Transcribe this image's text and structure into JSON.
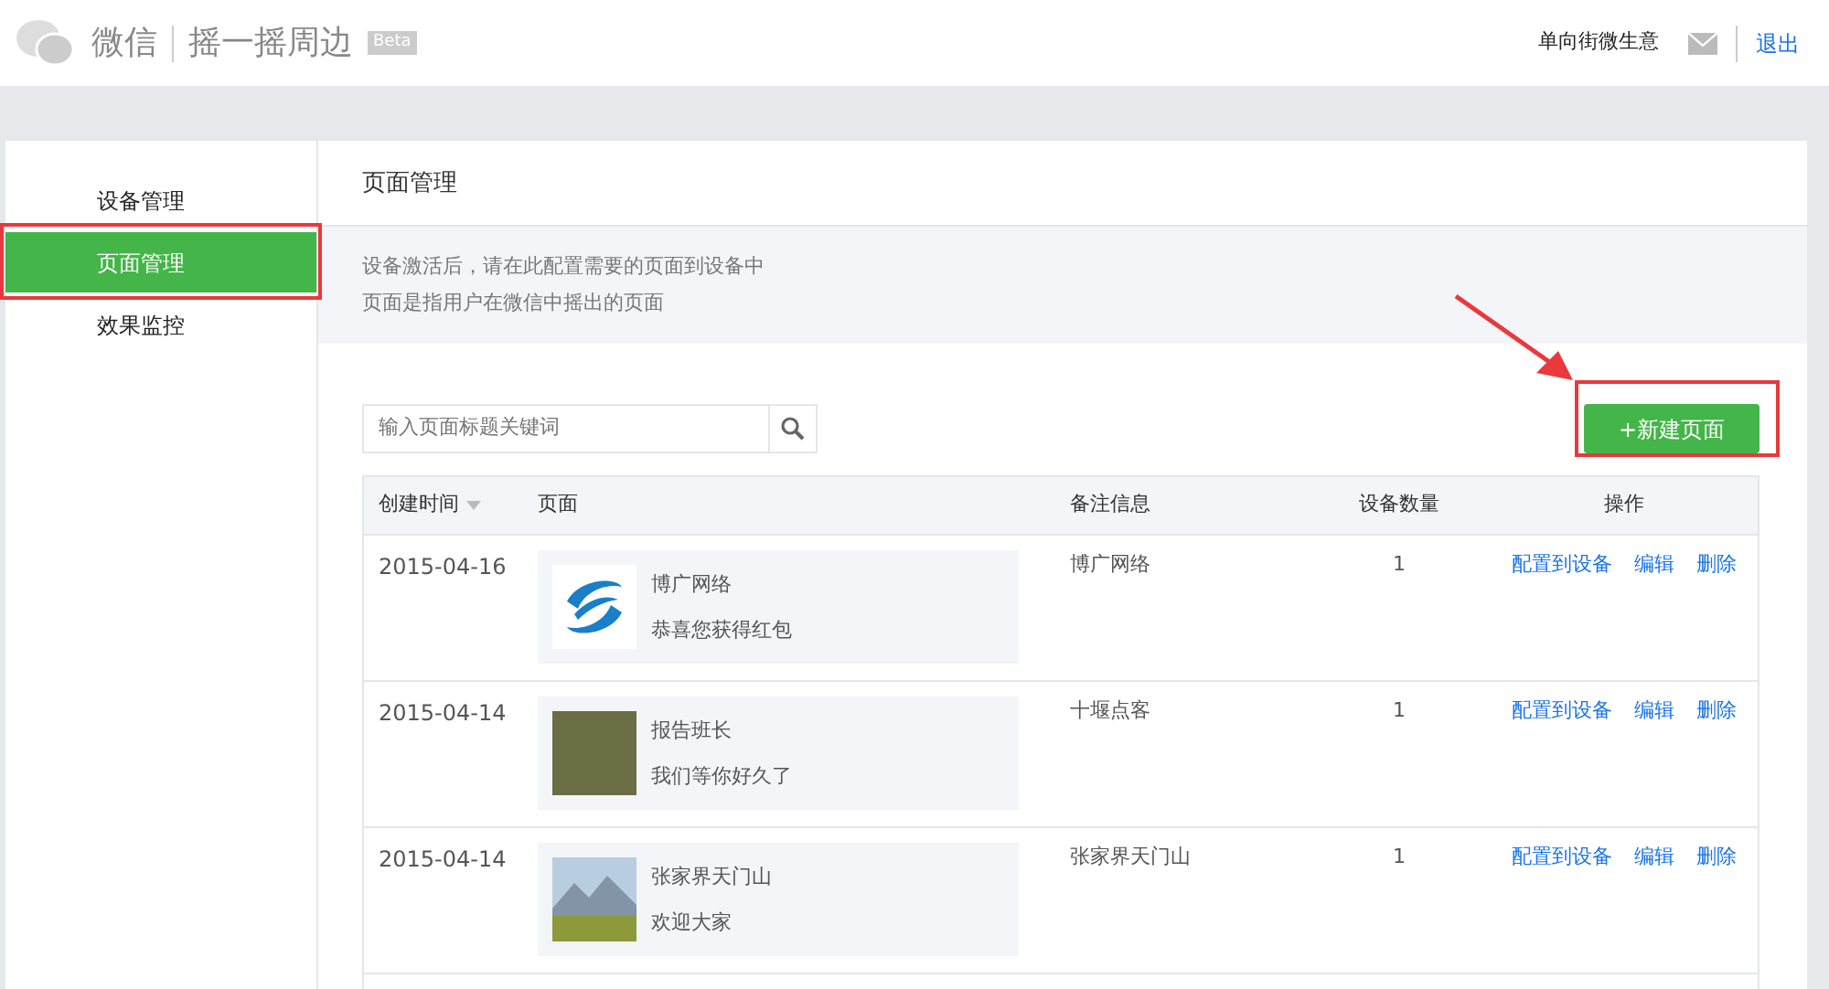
{
  "header": {
    "brand": "微信",
    "product": "摇一摇周边",
    "badge": "Beta",
    "account": "单向街微生意",
    "logout": "退出"
  },
  "sidebar": {
    "items": [
      {
        "label": "设备管理",
        "selected": false
      },
      {
        "label": "页面管理",
        "selected": true
      },
      {
        "label": "效果监控",
        "selected": false
      }
    ]
  },
  "content": {
    "title": "页面管理",
    "notes": [
      "设备激活后，请在此配置需要的页面到设备中",
      "页面是指用户在微信中摇出的页面"
    ],
    "search": {
      "placeholder": "输入页面标题关键词"
    },
    "new_button": "+新建页面",
    "table": {
      "columns": [
        "创建时间",
        "页面",
        "备注信息",
        "设备数量",
        "操作"
      ],
      "rows": [
        {
          "date": "2015-04-16",
          "kind": "logo",
          "title": "博广网络",
          "subtitle": "恭喜您获得红包",
          "note": "博广网络",
          "count": "1",
          "actions": [
            "配置到设备",
            "编辑",
            "删除"
          ]
        },
        {
          "date": "2015-04-14",
          "kind": "photo",
          "title": "报告班长",
          "subtitle": "我们等你好久了",
          "note": "十堰点客",
          "count": "1",
          "actions": [
            "配置到设备",
            "编辑",
            "删除"
          ]
        },
        {
          "date": "2015-04-14",
          "kind": "landscape",
          "title": "张家界天门山",
          "subtitle": "欢迎大家",
          "note": "张家界天门山",
          "count": "1",
          "actions": [
            "配置到设备",
            "编辑",
            "删除"
          ]
        }
      ]
    }
  }
}
